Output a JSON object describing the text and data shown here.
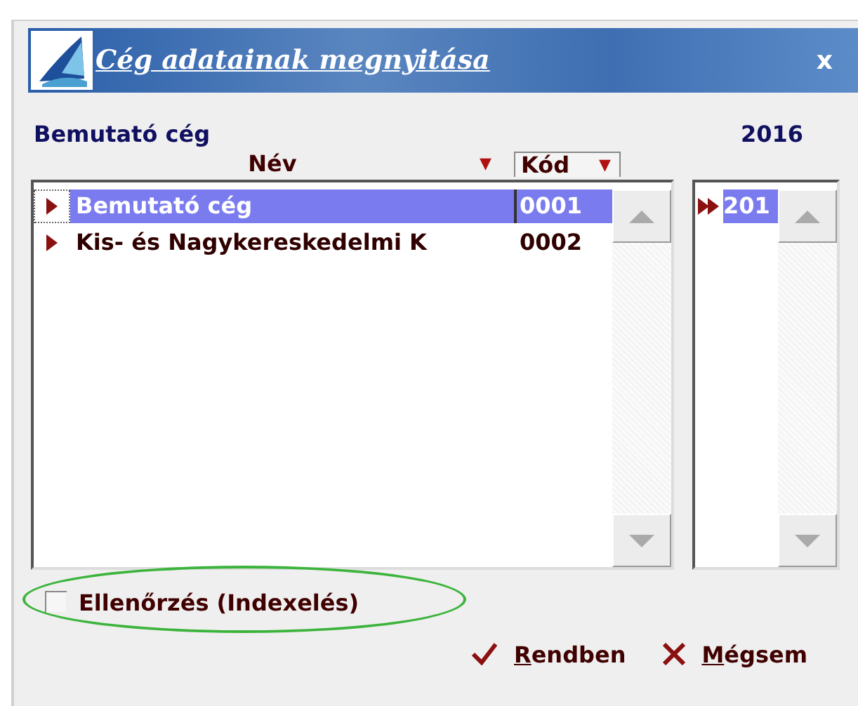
{
  "window": {
    "title": "Cég adatainak megnyitása",
    "close": "x"
  },
  "company_label": "Bemutató cég",
  "year_label": "2016",
  "table": {
    "columns": [
      {
        "label": "Név",
        "sort": "▼"
      },
      {
        "label": "Kód",
        "sort": "▼"
      }
    ],
    "rows": [
      {
        "name": "Bemutató cég",
        "code": "0001",
        "selected": true
      },
      {
        "name": "Kis- és Nagykereskedelmi K",
        "code": "0002",
        "selected": false
      }
    ]
  },
  "years": [
    {
      "label": "201",
      "selected": true
    }
  ],
  "check_option": {
    "label": "Ellenőrzés (Indexelés)",
    "checked": false,
    "highlighted": true
  },
  "buttons": [
    {
      "kind": "ok",
      "label": "Rendben"
    },
    {
      "kind": "cancel",
      "label": "Mégsem"
    }
  ]
}
